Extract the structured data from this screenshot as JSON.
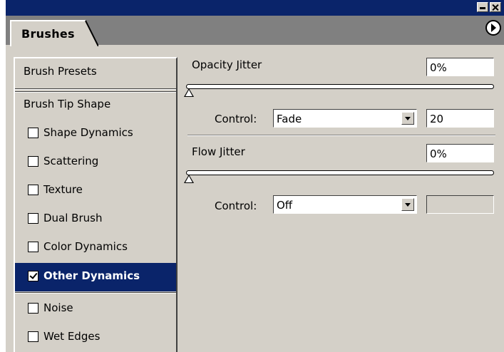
{
  "panel": {
    "tab_label": "Brushes",
    "title_buttons": [
      "minimize-icon",
      "close-icon"
    ],
    "menu_icon": "flyout-menu-icon"
  },
  "sidebar": {
    "items": [
      {
        "label": "Brush Presets",
        "has_checkbox": false,
        "checked": false,
        "selected": false
      },
      {
        "label": "Brush Tip Shape",
        "has_checkbox": false,
        "checked": false,
        "selected": false
      },
      {
        "label": "Shape Dynamics",
        "has_checkbox": true,
        "checked": false,
        "selected": false
      },
      {
        "label": "Scattering",
        "has_checkbox": true,
        "checked": false,
        "selected": false
      },
      {
        "label": "Texture",
        "has_checkbox": true,
        "checked": false,
        "selected": false
      },
      {
        "label": "Dual Brush",
        "has_checkbox": true,
        "checked": false,
        "selected": false
      },
      {
        "label": "Color Dynamics",
        "has_checkbox": true,
        "checked": false,
        "selected": false
      },
      {
        "label": "Other Dynamics",
        "has_checkbox": true,
        "checked": true,
        "selected": true
      },
      {
        "label": "Noise",
        "has_checkbox": true,
        "checked": false,
        "selected": false
      },
      {
        "label": "Wet Edges",
        "has_checkbox": true,
        "checked": false,
        "selected": false
      }
    ]
  },
  "opacity": {
    "label": "Opacity Jitter",
    "value": "0%",
    "slider_fraction": 0,
    "control_label": "Control:",
    "control_value": "Fade",
    "fade_steps": "20"
  },
  "flow": {
    "label": "Flow Jitter",
    "value": "0%",
    "slider_fraction": 0,
    "control_label": "Control:",
    "control_value": "Off",
    "fade_steps": ""
  },
  "colors": {
    "titlebar": "#0a246a",
    "selected_bg": "#0a246a",
    "panel_bg": "#d4d0c8",
    "tabstrip": "#808080"
  }
}
